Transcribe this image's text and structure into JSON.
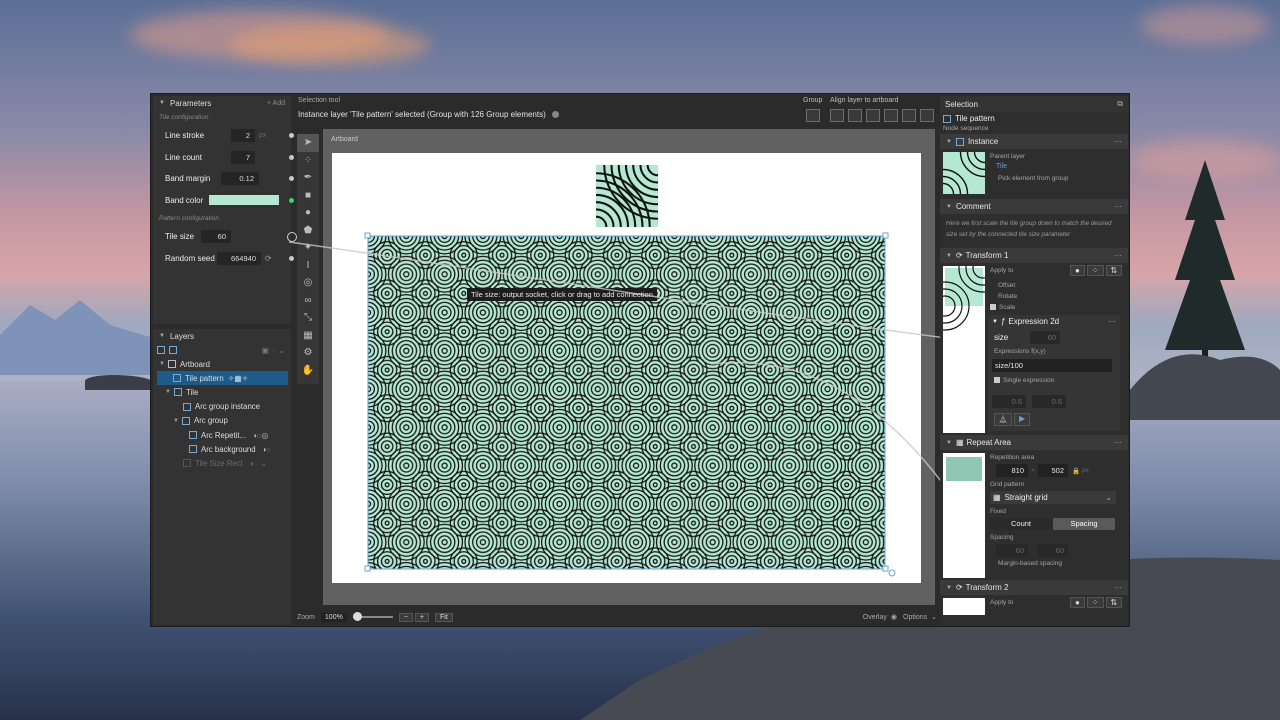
{
  "parameters": {
    "title": "Parameters",
    "add_label": "+ Add",
    "section_tile": "Tile configuration",
    "section_pattern": "Pattern configuration",
    "rows": [
      {
        "label": "Line stroke",
        "value": "2",
        "unit": "px"
      },
      {
        "label": "Line count",
        "value": "7",
        "unit": ""
      },
      {
        "label": "Band margin",
        "value": "0.12",
        "unit": ""
      },
      {
        "label": "Band color",
        "value": "",
        "unit": ""
      },
      {
        "label": "Tile size",
        "value": "60",
        "unit": ""
      },
      {
        "label": "Random seed",
        "value": "664940",
        "unit": ""
      }
    ],
    "band_color": "#b4e8d4"
  },
  "layers": {
    "title": "Layers",
    "items": [
      {
        "label": "Artboard"
      },
      {
        "label": "Tile pattern"
      },
      {
        "label": "Tile"
      },
      {
        "label": "Arc group instance"
      },
      {
        "label": "Arc group"
      },
      {
        "label": "Arc Repetit..."
      },
      {
        "label": "Arc background"
      },
      {
        "label": "Tile Size Rect"
      }
    ]
  },
  "topbar": {
    "mode": "Selection tool",
    "status": "Instance layer 'Tile pattern' selected (Group with 126 Group elements)",
    "group_label": "Group",
    "align_label": "Align layer to artboard"
  },
  "canvas": {
    "artboard_label": "Artboard",
    "tooltip": "Tile size: output socket, click or drag to add connection"
  },
  "bottombar": {
    "zoom_label": "Zoom",
    "zoom_value": "100%",
    "minus": "−",
    "plus": "+",
    "fit": "Fit",
    "overlay": "Overlay",
    "options": "Options"
  },
  "selection": {
    "title": "Selection",
    "layer_name": "Tile pattern",
    "node_sequence": "Node sequence",
    "instance": {
      "title": "Instance",
      "parent_layer_label": "Parent layer",
      "parent_value": "Tile",
      "pick_label": "Pick element from group"
    },
    "comment": {
      "title": "Comment",
      "text": "Here we first scale the tile group down to match the desired size set by the connected tile size parameter"
    },
    "transform1": {
      "title": "Transform 1",
      "apply_to": "Apply to",
      "options": [
        "Offset",
        "Rotate",
        "Scale"
      ],
      "expression_title": "Expression 2d",
      "size_label": "size",
      "size_value": "60",
      "expressions_label": "Expressions f(x,y)",
      "expression_value": "size/100",
      "single_expression": "Single expression",
      "out_x": "0.6",
      "out_y": "0.6"
    },
    "repeat": {
      "title": "Repeat Area",
      "rep_label": "Repetition area",
      "w": "810",
      "h": "502",
      "unit": "px",
      "grid_label": "Grid pattern",
      "grid_value": "Straight grid",
      "fixed_label": "Fixed",
      "count": "Count",
      "spacing_btn": "Spacing",
      "spacing_label": "Spacing",
      "sx": "60",
      "sy": "60",
      "margin_label": "Margin-based spacing"
    },
    "transform2": {
      "title": "Transform 2",
      "apply_to": "Apply to"
    }
  },
  "colors": {
    "accent": "#1e5a8a",
    "tile_fill": "#b4e8d4",
    "stroke": "#111111"
  }
}
